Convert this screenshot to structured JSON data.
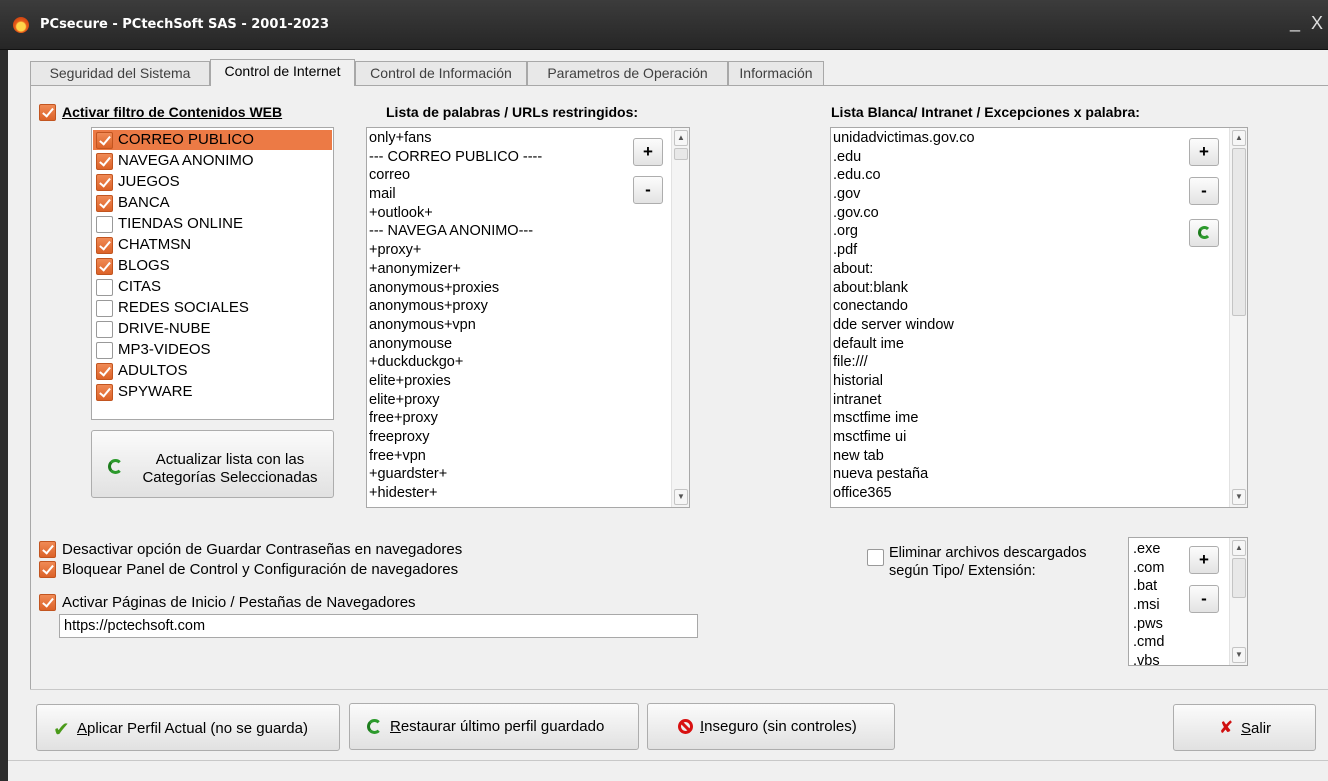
{
  "window": {
    "title": "PCsecure  -  PCtechSoft SAS - 2001-2023",
    "minimize": "_",
    "close": "X"
  },
  "tabs": [
    {
      "label": "Seguridad del Sistema",
      "active": false
    },
    {
      "label": "Control de Internet",
      "active": true
    },
    {
      "label": "Control de Información",
      "active": false
    },
    {
      "label": "Parametros de Operación",
      "active": false
    },
    {
      "label": "Información",
      "active": false
    }
  ],
  "filter": {
    "label": "Activar filtro de Contenidos WEB",
    "checked": true,
    "categories": [
      {
        "label": "CORREO PUBLICO",
        "checked": true,
        "selected": true
      },
      {
        "label": "NAVEGA ANONIMO",
        "checked": true
      },
      {
        "label": "JUEGOS",
        "checked": true
      },
      {
        "label": "BANCA",
        "checked": true
      },
      {
        "label": "TIENDAS ONLINE",
        "checked": false
      },
      {
        "label": "CHATMSN",
        "checked": true
      },
      {
        "label": "BLOGS",
        "checked": true
      },
      {
        "label": "CITAS",
        "checked": false
      },
      {
        "label": "REDES SOCIALES",
        "checked": false
      },
      {
        "label": "DRIVE-NUBE",
        "checked": false
      },
      {
        "label": "MP3-VIDEOS",
        "checked": false
      },
      {
        "label": "ADULTOS",
        "checked": true
      },
      {
        "label": "SPYWARE",
        "checked": true
      }
    ],
    "update_button": {
      "line1": "Actualizar lista con las",
      "line2": "Categorías Seleccionadas"
    }
  },
  "restricted": {
    "header": "Lista de palabras / URLs restringidos:",
    "items": [
      "only+fans",
      "---  CORREO PUBLICO ----",
      "correo",
      "mail",
      "+outlook+",
      "--- NAVEGA ANONIMO---",
      "+proxy+",
      "+anonymizer+",
      "anonymous+proxies",
      "anonymous+proxy",
      "anonymous+vpn",
      "anonymouse",
      "+duckduckgo+",
      "elite+proxies",
      "elite+proxy",
      "free+proxy",
      "freeproxy",
      "free+vpn",
      "+guardster+",
      "+hidester+"
    ],
    "add": "+",
    "remove": "-"
  },
  "whitelist": {
    "header": "Lista Blanca/ Intranet / Excepciones x palabra:",
    "items": [
      "unidadvictimas.gov.co",
      ".edu",
      ".edu.co",
      ".gov",
      ".gov.co",
      ".org",
      ".pdf",
      "about:",
      "about:blank",
      "conectando",
      "dde server window",
      "default ime",
      "file:///",
      "historial",
      "intranet",
      "msctfime ime",
      "msctfime ui",
      "new tab",
      "nueva pestaña",
      "office365"
    ],
    "add": "+",
    "remove": "-"
  },
  "options": {
    "disable_passwords": {
      "label": "Desactivar opción de Guardar Contraseñas en navegadores",
      "checked": true
    },
    "block_panel": {
      "label": "Bloquear Panel de Control y Configuración de navegadores",
      "checked": true
    },
    "home_pages": {
      "label": "Activar Páginas de Inicio / Pestañas de Navegadores",
      "checked": true
    },
    "home_url": "https://pctechsoft.com"
  },
  "downloads": {
    "label_line1": "Eliminar archivos descargados",
    "label_line2": "según Tipo/ Extensión:",
    "checked": false,
    "extensions": [
      ".exe",
      ".com",
      ".bat",
      ".msi",
      ".pws",
      ".cmd",
      ".vbs"
    ],
    "add": "+",
    "remove": "-"
  },
  "footer": {
    "apply": {
      "accel": "A",
      "rest": "plicar Perfil Actual (no se guarda)"
    },
    "restore": {
      "accel": "R",
      "rest": "estaurar último perfil guardado"
    },
    "insecure": {
      "accel": "I",
      "rest": "nseguro (sin controles)"
    },
    "exit": {
      "accel": "S",
      "rest": "alir"
    }
  },
  "colors": {
    "accent_checkbox": "#e26a30",
    "selected_row": "#ec7a45",
    "refresh_green": "#2c9a2c",
    "danger_red": "#d81010"
  }
}
